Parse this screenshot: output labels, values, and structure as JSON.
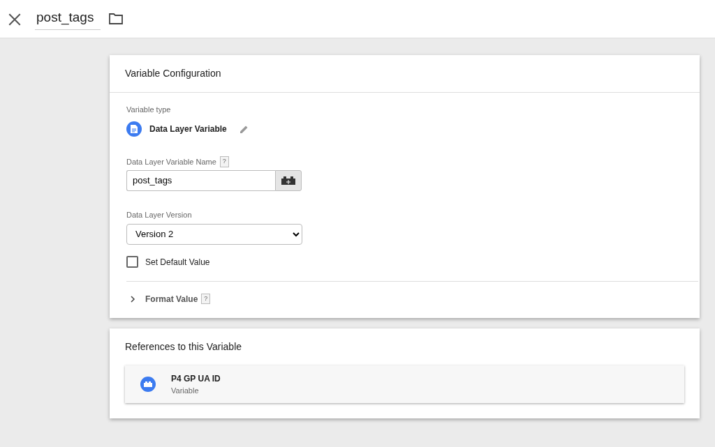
{
  "header": {
    "title": "post_tags"
  },
  "config": {
    "title": "Variable Configuration",
    "type_label": "Variable type",
    "type_name": "Data Layer Variable",
    "name_label": "Data Layer Variable Name",
    "name_help": "?",
    "name_value": "post_tags",
    "version_label": "Data Layer Version",
    "version_value": "Version 2",
    "default_value": {
      "label": "Set Default Value",
      "checked": false
    },
    "format_value": {
      "label": "Format Value",
      "help": "?",
      "expanded": false
    }
  },
  "references": {
    "title": "References to this Variable",
    "items": [
      {
        "name": "P4 GP UA ID",
        "type": "Variable"
      }
    ]
  }
}
